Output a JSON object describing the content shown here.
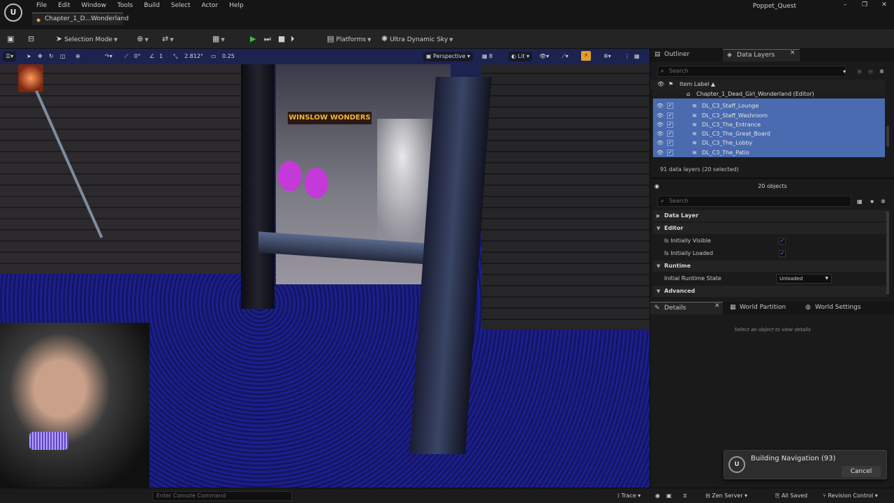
{
  "menubar": {
    "logo": "U",
    "items": [
      "File",
      "Edit",
      "Window",
      "Tools",
      "Build",
      "Select",
      "Actor",
      "Help"
    ],
    "project_name": "Poppet_Quest",
    "level_tab": "Chapter_1_D...Wonderland",
    "window_controls": [
      "–",
      "❐",
      "✕"
    ]
  },
  "toolbar": {
    "selection_mode": "Selection Mode",
    "platforms": "Platforms",
    "sky": "Ultra Dynamic Sky"
  },
  "viewport": {
    "rotation_snap": "0°",
    "grid_snap": "1",
    "scale_value": "2.812°",
    "camera_speed": "0.25",
    "perspective": "Perspective",
    "fov": "8",
    "view_mode": "Lit",
    "shop_sign": "WINSLOW WONDERS"
  },
  "statusbar": {
    "console_placeholder": "Enter Console Command",
    "trace": "Trace",
    "zen_server": "Zen Server",
    "all_saved": "All Saved",
    "revision_control": "Revision Control"
  },
  "data_layers_panel": {
    "tabs": {
      "outliner": "Outliner",
      "data_layers": "Data Layers"
    },
    "search_placeholder": "Search",
    "column_header": "Item Label ▲",
    "root": "Chapter_1_Dead_Girl_Wonderland (Editor)",
    "rows": [
      "DL_C3_Staff_Lounge",
      "DL_C3_Staff_Washroom",
      "DL_C3_The_Entrance",
      "DL_C3_The_Great_Board",
      "DL_C3_The_Lobby",
      "DL_C3_The_Patio"
    ],
    "count": "91 data layers (20 selected)"
  },
  "properties_panel": {
    "object_count": "20 objects",
    "search_placeholder": "Search",
    "sections": {
      "data_layer": "Data Layer",
      "editor": "Editor",
      "runtime": "Runtime",
      "advanced": "Advanced"
    },
    "initially_visible_label": "Is Initially Visible",
    "initially_loaded_label": "Is Initially Loaded",
    "runtime_state_label": "Initial Runtime State",
    "runtime_state_value": "Unloaded"
  },
  "details_panel": {
    "tabs": {
      "details": "Details",
      "world_partition": "World Partition",
      "world_settings": "World Settings"
    },
    "empty_message": "Select an object to view details"
  },
  "notification": {
    "title": "Building Navigation (93)",
    "cancel": "Cancel"
  },
  "colors": {
    "selection": "#4a6bb0",
    "play": "#3fbf3f",
    "accent": "#e3a025"
  }
}
